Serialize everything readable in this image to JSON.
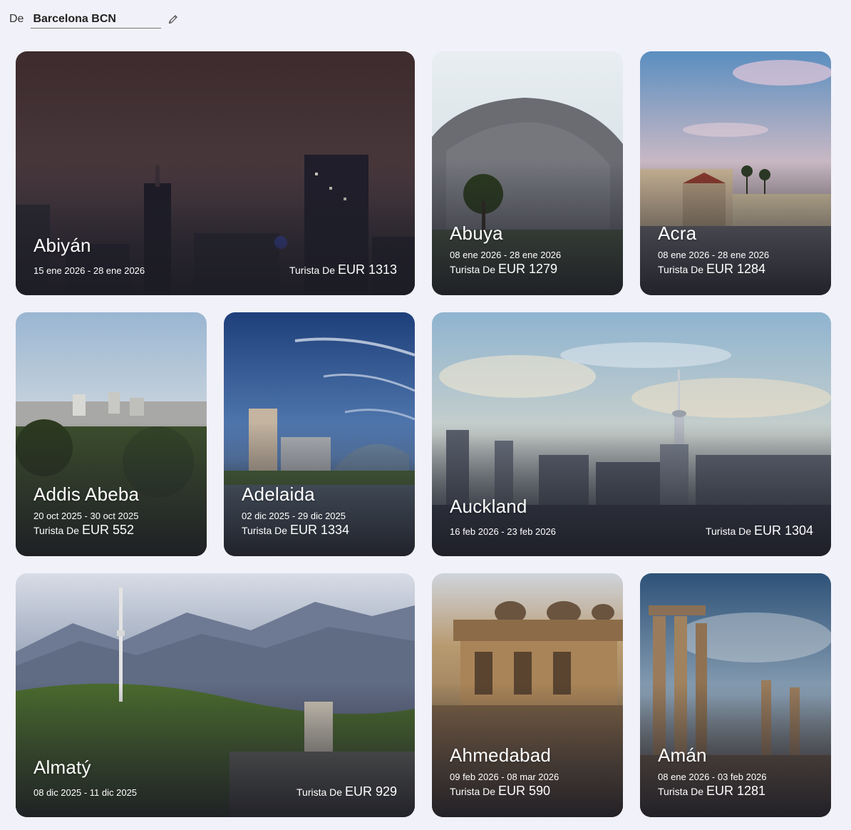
{
  "origin": {
    "label": "De",
    "value": "Barcelona BCN"
  },
  "cards": [
    {
      "city": "Abiyán",
      "dates": "15 ene 2026 - 28 ene 2026",
      "fare_label": "Turista De",
      "price": "EUR 1313"
    },
    {
      "city": "Abuya",
      "dates": "08 ene 2026 - 28 ene 2026",
      "fare_label": "Turista De",
      "price": "EUR 1279"
    },
    {
      "city": "Acra",
      "dates": "08 ene 2026 - 28 ene 2026",
      "fare_label": "Turista De",
      "price": "EUR 1284"
    },
    {
      "city": "Addis Abeba",
      "dates": "20 oct 2025 - 30 oct 2025",
      "fare_label": "Turista De",
      "price": "EUR 552"
    },
    {
      "city": "Adelaida",
      "dates": "02 dic 2025 - 29 dic 2025",
      "fare_label": "Turista De",
      "price": "EUR 1334"
    },
    {
      "city": "Auckland",
      "dates": "16 feb 2026 - 23 feb 2026",
      "fare_label": "Turista De",
      "price": "EUR 1304"
    },
    {
      "city": "Almatý",
      "dates": "08 dic 2025 - 11 dic 2025",
      "fare_label": "Turista De",
      "price": "EUR 929"
    },
    {
      "city": "Ahmedabad",
      "dates": "09 feb 2026 - 08 mar 2026",
      "fare_label": "Turista De",
      "price": "EUR 590"
    },
    {
      "city": "Amán",
      "dates": "08 ene 2026 - 03 feb 2026",
      "fare_label": "Turista De",
      "price": "EUR 1281"
    }
  ],
  "icons": {
    "edit": "pencil-icon"
  }
}
